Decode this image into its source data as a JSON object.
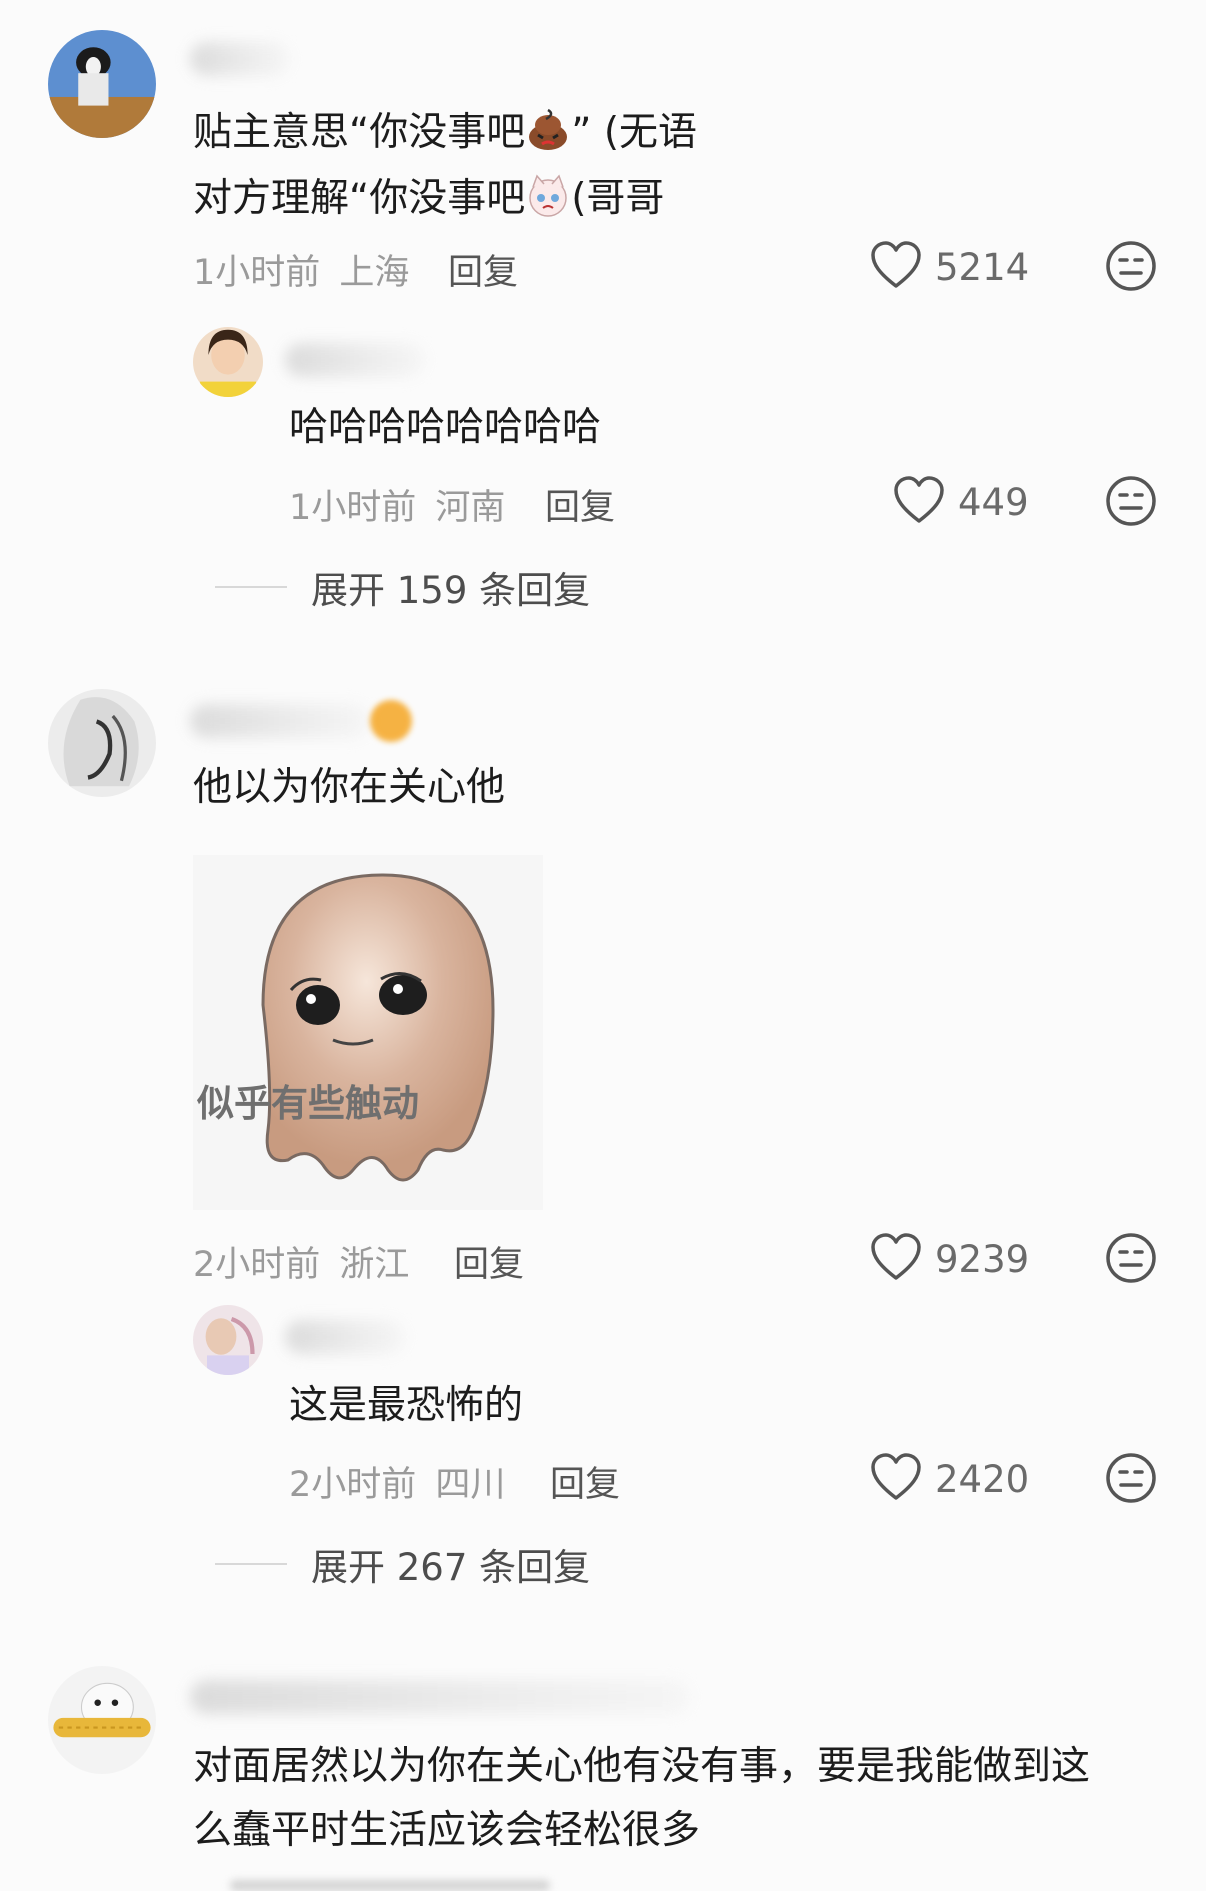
{
  "comments": [
    {
      "text_line1_pre": "贴主意思“你没事吧",
      "text_line1_post": "” (无语",
      "text_line2_pre": "对方理解“你没事吧",
      "text_line2_post": "(哥哥",
      "time": "1小时前",
      "location": "上海",
      "reply_label": "回复",
      "likes": "5214",
      "replies": [
        {
          "text": "哈哈哈哈哈哈哈哈",
          "time": "1小时前",
          "location": "河南",
          "reply_label": "回复",
          "likes": "449"
        }
      ],
      "expand_label": "展开 159 条回复"
    },
    {
      "text": "他以为你在关心他",
      "sticker_caption": "似乎有些触动",
      "time": "2小时前",
      "location": "浙江",
      "reply_label": "回复",
      "likes": "9239",
      "replies": [
        {
          "text": "这是最恐怖的",
          "time": "2小时前",
          "location": "四川",
          "reply_label": "回复",
          "likes": "2420"
        }
      ],
      "expand_label": "展开 267 条回复"
    },
    {
      "text_line1": "对面居然以为你在关心他有没有事，要是我能做到这",
      "text_line2": "么蠢平时生活应该会轻松很多"
    }
  ],
  "icons": {
    "like": "heart-outline-icon",
    "dislike": "meh-face-icon"
  }
}
